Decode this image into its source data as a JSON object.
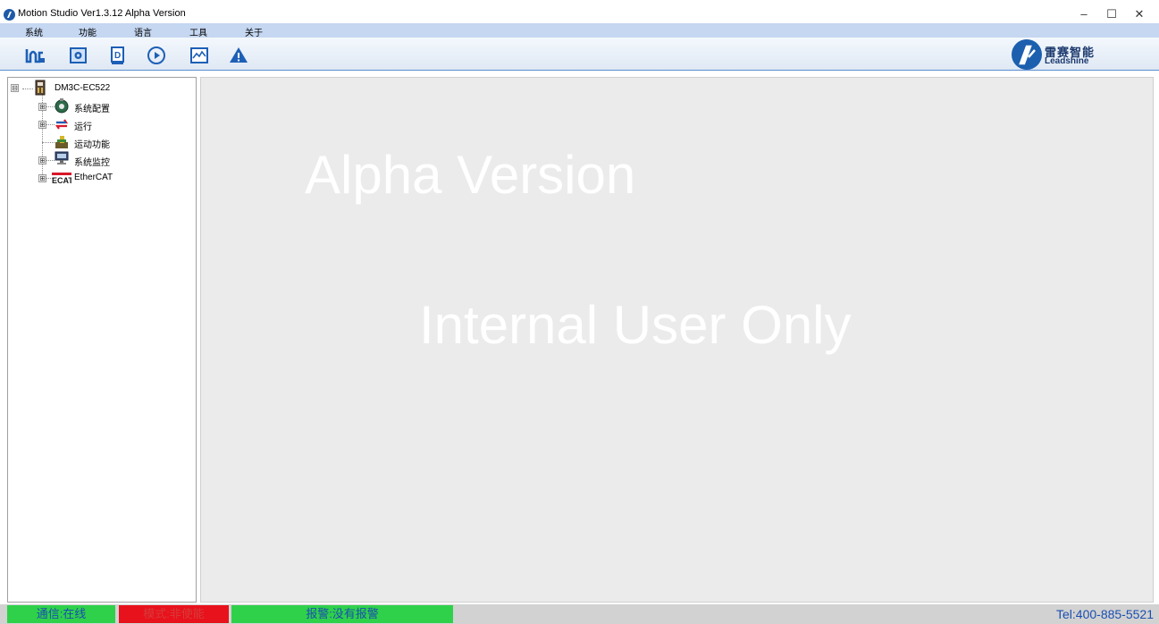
{
  "window": {
    "title": "Motion Studio  Ver1.3.12 Alpha Version",
    "controls": {
      "minimize": "–",
      "maximize": "☐",
      "close": "✕"
    }
  },
  "menu": {
    "items": [
      {
        "label": "系统"
      },
      {
        "label": "功能"
      },
      {
        "label": "语言"
      },
      {
        "label": "工具"
      },
      {
        "label": "关于"
      }
    ]
  },
  "toolbar": {
    "tools": [
      {
        "icon": "connect-icon"
      },
      {
        "icon": "parameter-icon"
      },
      {
        "icon": "document-icon"
      },
      {
        "icon": "run-icon"
      },
      {
        "icon": "scope-icon"
      },
      {
        "icon": "alarm-icon"
      }
    ],
    "brand": {
      "cn": "雷赛智能",
      "en": "Leadshine"
    }
  },
  "tree": {
    "root": {
      "label": "DM3C-EC522",
      "expander": "⊟"
    },
    "children": [
      {
        "label": "系统配置",
        "icon": "system-config-icon",
        "expander": "⊞"
      },
      {
        "label": "运行",
        "icon": "run-cycle-icon",
        "expander": "⊞"
      },
      {
        "label": "运动功能",
        "icon": "motion-function-icon",
        "expander": ""
      },
      {
        "label": "系统监控",
        "icon": "system-monitor-icon",
        "expander": "⊞"
      },
      {
        "label": "EtherCAT",
        "icon": "ethercat-icon",
        "expander": "⊞"
      }
    ]
  },
  "main": {
    "watermark_top": "Alpha Version",
    "watermark_bottom": "Internal User Only"
  },
  "status": {
    "communication": "通信:在线",
    "mode": "模式:非使能",
    "alarm": "报警:没有报警",
    "tel": "Tel:400-885-5521"
  },
  "colors": {
    "status_ok": "#2fd14a",
    "status_bad": "#e8121c",
    "menu_bg": "#c5d7f1",
    "brand_blue": "#1c5fae"
  }
}
